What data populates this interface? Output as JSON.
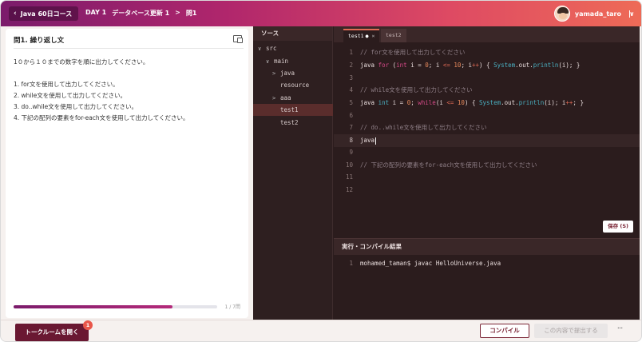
{
  "header": {
    "back_label": "Java 60日コース",
    "breadcrumb": {
      "day": "DAY 1",
      "lesson": "データベース更新 1",
      "separator": ">",
      "question": "問1"
    },
    "user_name": "yamada_taro"
  },
  "problem": {
    "title": "問1. 繰り返し文",
    "intro": "1０から１０までの数字を順に出力してください。",
    "tasks": [
      "1. for文を使用して出力してください。",
      "2. while文を使用して出力してください。",
      "3. do..while文を使用して出力してください。",
      "4. 下記の配列の要素をfor-each文を使用して出力してください。"
    ],
    "progress_fraction": 0.78,
    "progress_label": "1 / 7問"
  },
  "file_tree": {
    "header": "ソース",
    "items": [
      {
        "label": "src",
        "arrow": "∨"
      },
      {
        "label": "main",
        "arrow": "∨"
      },
      {
        "label": "java",
        "arrow": ">"
      },
      {
        "label": "resource",
        "arrow": ""
      },
      {
        "label": "aaa",
        "arrow": ">"
      },
      {
        "label": "test1",
        "arrow": ""
      },
      {
        "label": "test2",
        "arrow": ""
      }
    ],
    "selected": "test1"
  },
  "editor": {
    "tabs": [
      {
        "label": "test1",
        "dot": "●",
        "close": "×"
      },
      {
        "label": "test2"
      }
    ],
    "lines": [
      {
        "n": "1",
        "text": "// for文を使用して出力してください"
      },
      {
        "n": "2",
        "text": "java for (int i = 0; i <= 10; i++) { System.out.println(i); }"
      },
      {
        "n": "3",
        "text": ""
      },
      {
        "n": "4",
        "text": "// while文を使用して出力してください"
      },
      {
        "n": "5",
        "text": "java int i = 0; while(i <= 10) { System.out.println(i); i++; }"
      },
      {
        "n": "6",
        "text": ""
      },
      {
        "n": "7",
        "text": "// do..while文を使用して出力してください"
      },
      {
        "n": "8",
        "text": "java"
      },
      {
        "n": "9",
        "text": ""
      },
      {
        "n": "10",
        "text": "// 下記の配列の要素をfor-each文を使用して出力してください"
      },
      {
        "n": "11",
        "text": ""
      },
      {
        "n": "12",
        "text": ""
      }
    ],
    "save_label": "保存 (S)"
  },
  "console": {
    "title": "実行・コンパイル結果",
    "line_no": "1",
    "output": "mohamed_taman$ javac HelloUniverse.java"
  },
  "footer": {
    "talk_label": "トークルームを開く",
    "talk_badge": "1",
    "compile_label": "コンパイル",
    "submit_label": "この内容で提出する",
    "more_label": "···"
  },
  "colors": {
    "header_gradient_start": "#7b1b6b",
    "header_gradient_end": "#ee6b57",
    "accent": "#7a2535",
    "editor_bg": "#2b1c1d"
  }
}
